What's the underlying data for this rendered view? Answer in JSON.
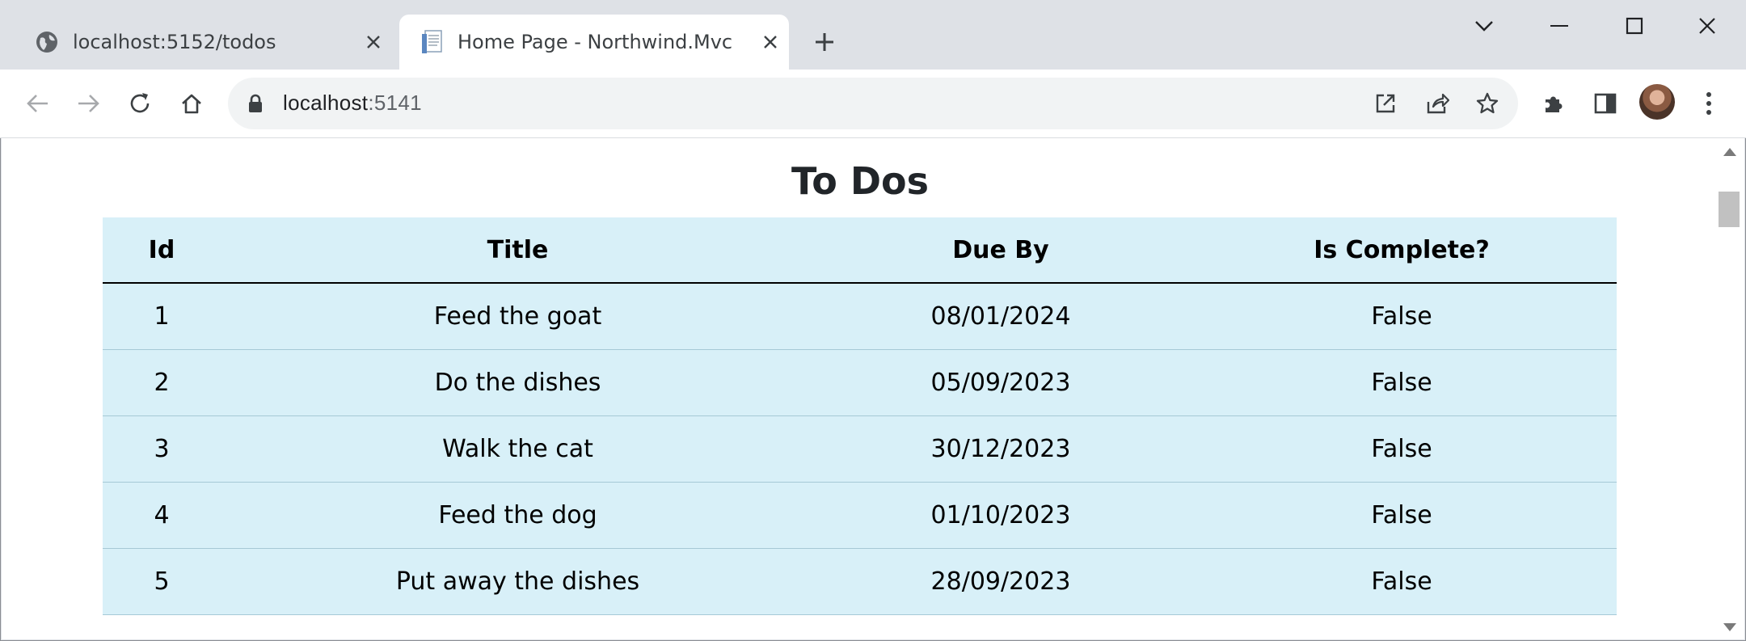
{
  "tabs": [
    {
      "title": "localhost:5152/todos",
      "icon": "globe-icon",
      "active": false
    },
    {
      "title": "Home Page - Northwind.Mvc",
      "icon": "document-icon",
      "active": true
    }
  ],
  "address_bar": {
    "host": "localhost",
    "port": ":5141"
  },
  "page": {
    "heading": "To Dos",
    "columns": [
      "Id",
      "Title",
      "Due By",
      "Is Complete?"
    ],
    "rows": [
      {
        "id": "1",
        "title": "Feed the goat",
        "due_by": "08/01/2024",
        "is_complete": "False"
      },
      {
        "id": "2",
        "title": "Do the dishes",
        "due_by": "05/09/2023",
        "is_complete": "False"
      },
      {
        "id": "3",
        "title": "Walk the cat",
        "due_by": "30/12/2023",
        "is_complete": "False"
      },
      {
        "id": "4",
        "title": "Feed the dog",
        "due_by": "01/10/2023",
        "is_complete": "False"
      },
      {
        "id": "5",
        "title": "Put away the dishes",
        "due_by": "28/09/2023",
        "is_complete": "False"
      }
    ]
  },
  "colors": {
    "table_background": "#d8f0f8",
    "tab_strip": "#dee1e6",
    "omnibox": "#f1f3f4"
  }
}
